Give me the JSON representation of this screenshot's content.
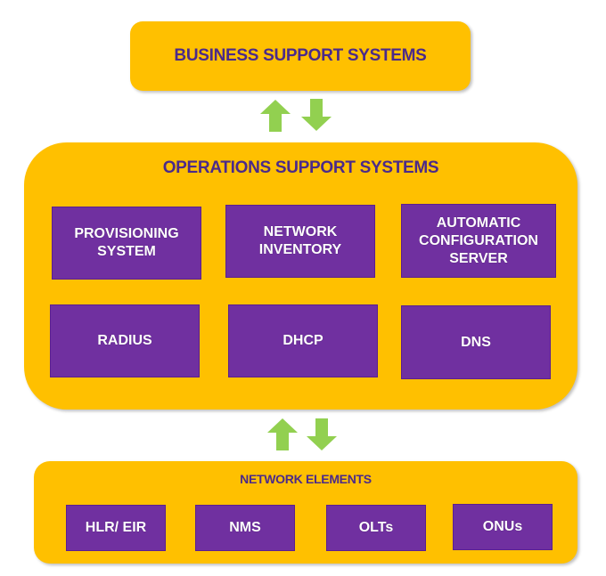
{
  "bss": {
    "title": "BUSINESS SUPPORT SYSTEMS"
  },
  "oss": {
    "title": "OPERATIONS SUPPORT SYSTEMS",
    "items": [
      "PROVISIONING\nSYSTEM",
      "NETWORK\nINVENTORY",
      "AUTOMATIC\nCONFIGURATION\nSERVER",
      "RADIUS",
      "DHCP",
      "DNS"
    ]
  },
  "network_elements": {
    "title": "NETWORK ELEMENTS",
    "items": [
      "HLR/ EIR",
      "NMS",
      "OLTs",
      "ONUs"
    ]
  },
  "colors": {
    "container": "#FFC000",
    "box": "#7030A0",
    "arrow": "#92D050",
    "title_text": "#4B2A8A"
  }
}
